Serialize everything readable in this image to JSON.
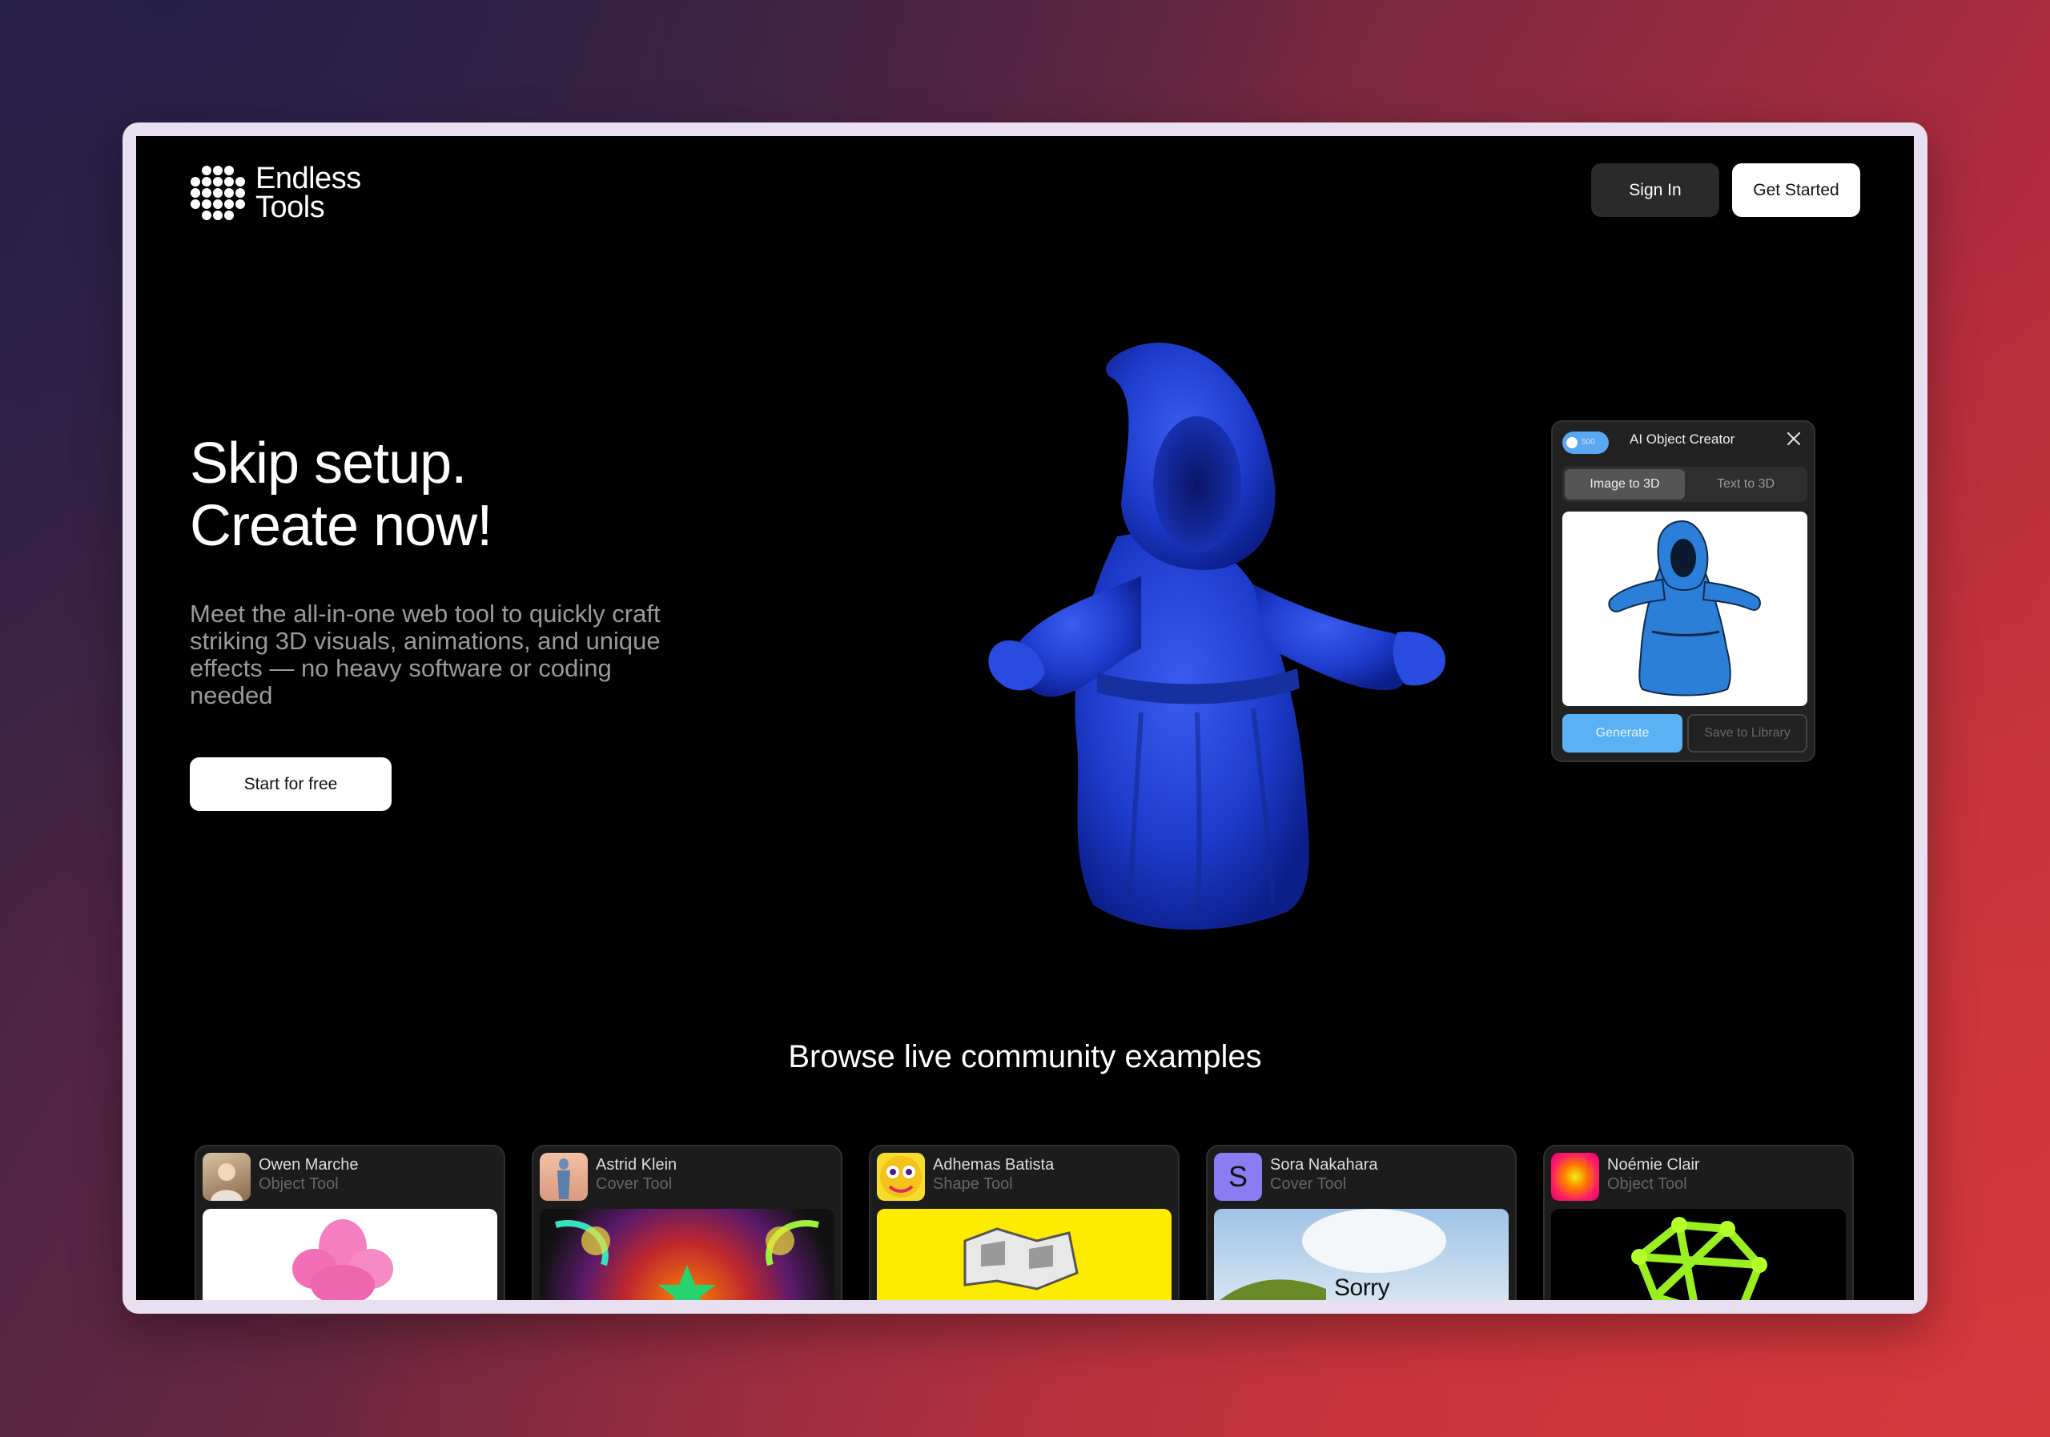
{
  "brand": {
    "line1": "Endless",
    "line2": "Tools"
  },
  "header": {
    "signin_label": "Sign In",
    "started_label": "Get Started"
  },
  "hero": {
    "title_line1": "Skip setup.",
    "title_line2": "Create now!",
    "subtitle": "Meet the all-in-one web tool to quickly craft striking 3D visuals, animations, and unique effects — no heavy software or coding needed",
    "cta_label": "Start for free"
  },
  "panel": {
    "toggle_value": "500",
    "title": "AI Object Creator",
    "tab_active": "Image to 3D",
    "tab_inactive": "Text to 3D",
    "generate_label": "Generate",
    "save_label": "Save to Library"
  },
  "community": {
    "title": "Browse live community examples",
    "cards": [
      {
        "name": "Owen Marche",
        "tool": "Object Tool"
      },
      {
        "name": "Astrid Klein",
        "tool": "Cover Tool"
      },
      {
        "name": "Adhemas Batista",
        "tool": "Shape Tool"
      },
      {
        "name": "Sora Nakahara",
        "tool": "Cover Tool",
        "avatar_letter": "S",
        "thumb_text": "Sorry"
      },
      {
        "name": "Noémie Clair",
        "tool": "Object Tool"
      }
    ]
  },
  "colors": {
    "accent_blue": "#5ab1f3",
    "figure_blue": "#1f3fd0",
    "background": "#000000"
  }
}
